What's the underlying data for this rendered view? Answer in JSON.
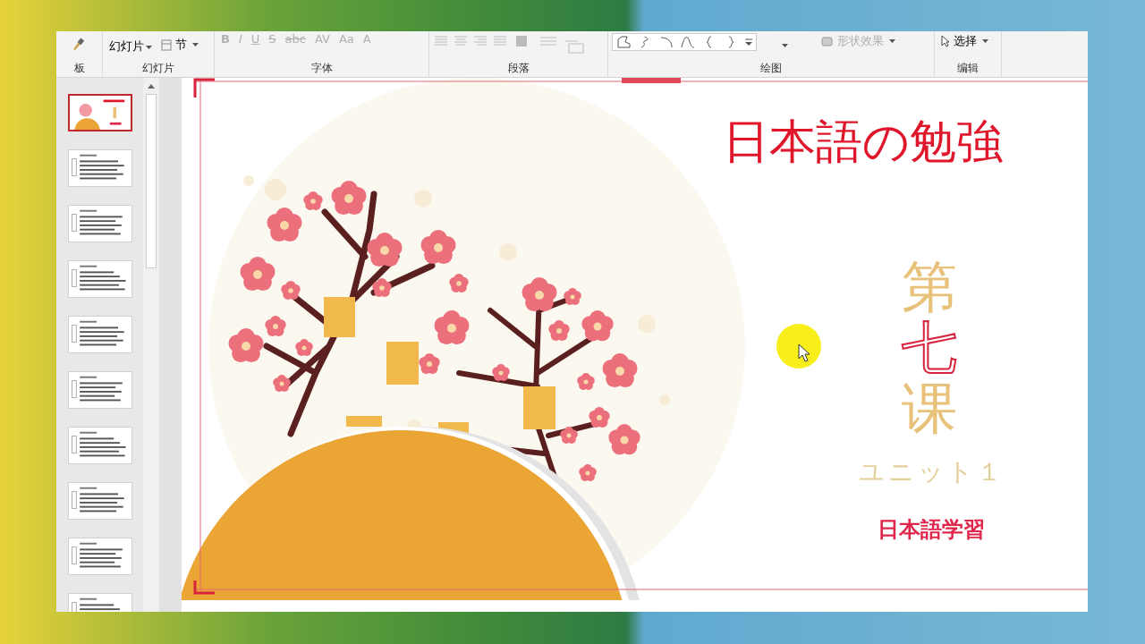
{
  "ribbon": {
    "groups": [
      {
        "kind": "clipboard",
        "label": "板"
      },
      {
        "kind": "slides",
        "label": "幻灯片",
        "new_slide": "幻灯片",
        "section": "节"
      },
      {
        "kind": "font",
        "label": "字体",
        "disabled": true,
        "buttons": [
          "B",
          "I",
          "U",
          "S",
          "abc",
          "AV",
          "Aa",
          "A"
        ]
      },
      {
        "kind": "paragraph",
        "label": "段落",
        "disabled": true
      },
      {
        "kind": "drawing",
        "label": "绘图",
        "shape_effects": {
          "label": "形状效果",
          "disabled": true
        }
      },
      {
        "kind": "editing",
        "label": "编辑",
        "select": "选择"
      }
    ]
  },
  "thumbnails": [
    {
      "selected": true
    },
    {
      "selected": false
    },
    {
      "selected": false
    },
    {
      "selected": false
    },
    {
      "selected": false
    },
    {
      "selected": false
    },
    {
      "selected": false
    },
    {
      "selected": false
    },
    {
      "selected": false
    },
    {
      "selected": false
    }
  ],
  "slide": {
    "title": "日本語の勉強",
    "vertical_title": [
      {
        "text": "第",
        "kind": "plain"
      },
      {
        "text": "七",
        "kind": "accent"
      },
      {
        "text": "课",
        "kind": "plain"
      }
    ],
    "unit": "ユニット１",
    "subtitle": "日本語学習"
  }
}
